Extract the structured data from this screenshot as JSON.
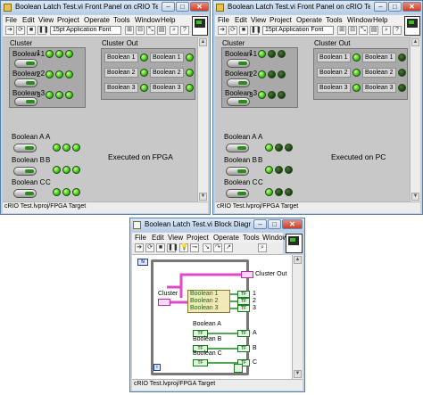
{
  "menus": [
    "File",
    "Edit",
    "View",
    "Project",
    "Operate",
    "Tools",
    "Window",
    "Help"
  ],
  "font_selector": "15pt Application Font",
  "left_window": {
    "title": "Boolean Latch Test.vi Front Panel on cRIO Test.lvproj/F...",
    "cluster_label": "Cluster",
    "cluster_out_label": "Cluster Out",
    "boolean_labels": [
      "Boolean 1",
      "Boolean 2",
      "Boolean 3"
    ],
    "numbers": [
      "1",
      "2",
      "3"
    ],
    "standalone_labels": [
      "Boolean A",
      "Boolean B",
      "Boolean C"
    ],
    "letters": [
      "A",
      "B",
      "C"
    ],
    "led_rows": [
      [
        true,
        true,
        true
      ],
      [
        true,
        true,
        true
      ],
      [
        true,
        true,
        true
      ]
    ],
    "standalone_leds": [
      [
        true,
        true,
        true
      ],
      [
        true,
        true,
        true
      ],
      [
        true,
        true,
        true
      ]
    ],
    "out_leds": [
      [
        true,
        true
      ],
      [
        true,
        true
      ],
      [
        true,
        true
      ]
    ],
    "note": "Executed on FPGA",
    "status": "cRIO Test.lvproj/FPGA Target"
  },
  "right_window": {
    "title": "Boolean Latch Test.vi Front Panel on cRIO Test.lvproj/F...",
    "cluster_label": "Cluster",
    "cluster_out_label": "Cluster Out",
    "boolean_labels": [
      "Boolean 1",
      "Boolean 2",
      "Boolean 3"
    ],
    "numbers": [
      "1",
      "2",
      "3"
    ],
    "standalone_labels": [
      "Boolean A",
      "Boolean B",
      "Boolean C"
    ],
    "letters": [
      "A",
      "B",
      "C"
    ],
    "led_rows": [
      [
        true,
        false,
        false
      ],
      [
        true,
        false,
        false
      ],
      [
        true,
        false,
        false
      ]
    ],
    "standalone_leds": [
      [
        true,
        false,
        false
      ],
      [
        true,
        false,
        false
      ],
      [
        true,
        false,
        false
      ]
    ],
    "out_leds": [
      [
        true,
        false
      ],
      [
        true,
        false
      ],
      [
        true,
        false
      ]
    ],
    "note": "Executed on PC",
    "status": "cRIO Test.lvproj/FPGA Target"
  },
  "bottom_window": {
    "title": "Boolean Latch Test.vi Block Diagram on cR...",
    "cluster_label": "Cluster",
    "cluster_out_label": "Cluster Out",
    "unbundle_items": [
      "Boolean 1",
      "Boolean 2",
      "Boolean 3"
    ],
    "numbers": [
      "1",
      "2",
      "3"
    ],
    "standalone_labels": [
      "Boolean A",
      "Boolean B",
      "Boolean C"
    ],
    "letters": [
      "A",
      "B",
      "C"
    ],
    "tf_label": "TF",
    "iteration_label": "N",
    "index_label": "i",
    "status": "cRIO Test.lvproj/FPGA Target"
  }
}
